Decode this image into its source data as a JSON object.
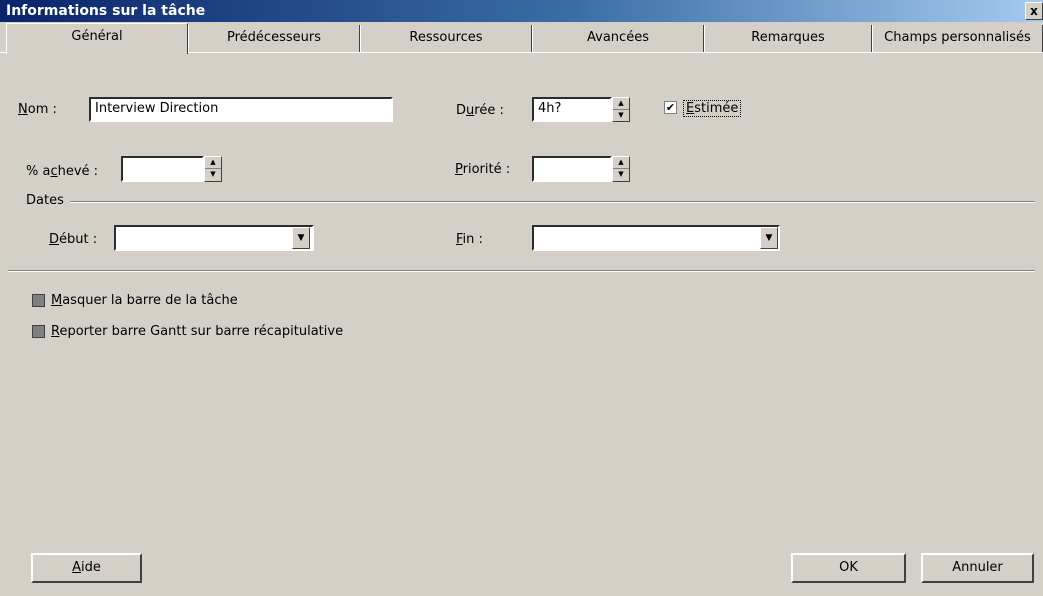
{
  "window": {
    "title": "Informations sur la tâche",
    "close_glyph": "x"
  },
  "tabs": [
    {
      "label": "Général",
      "active": true
    },
    {
      "label": "Prédécesseurs",
      "active": false
    },
    {
      "label": "Ressources",
      "active": false
    },
    {
      "label": "Avancées",
      "active": false
    },
    {
      "label": "Remarques",
      "active": false
    },
    {
      "label": "Champs personnalisés",
      "active": false
    }
  ],
  "form": {
    "nom": {
      "label_mn": "N",
      "label_rest": "om :",
      "value": "Interview Direction"
    },
    "duree": {
      "label_pre": "D",
      "label_mn": "u",
      "label_rest": "rée :",
      "value": "4h?"
    },
    "estimee": {
      "label_mn": "E",
      "label_rest": "stimée",
      "checked": true,
      "check_glyph": "✔"
    },
    "achevement": {
      "label_pre": "% a",
      "label_mn": "c",
      "label_rest": "hevé :",
      "value": ""
    },
    "priorite": {
      "label_mn": "P",
      "label_rest": "riorité :",
      "value": ""
    },
    "dates_group": "Dates",
    "debut": {
      "label_mn": "D",
      "label_rest": "ébut :",
      "value": ""
    },
    "fin": {
      "label_mn": "F",
      "label_rest": "in :",
      "value": ""
    },
    "masquer": {
      "label_mn": "M",
      "label_rest": "asquer la barre de la tâche",
      "checked": false
    },
    "reporter": {
      "label_mn": "R",
      "label_rest": "eporter barre Gantt sur barre récapitulative",
      "checked": false
    }
  },
  "icons": {
    "spin_up": "▲",
    "spin_down": "▼",
    "dropdown": "▼"
  },
  "buttons": {
    "aide": {
      "label_mn": "A",
      "label_rest": "ide"
    },
    "ok": "OK",
    "annuler": "Annuler"
  }
}
